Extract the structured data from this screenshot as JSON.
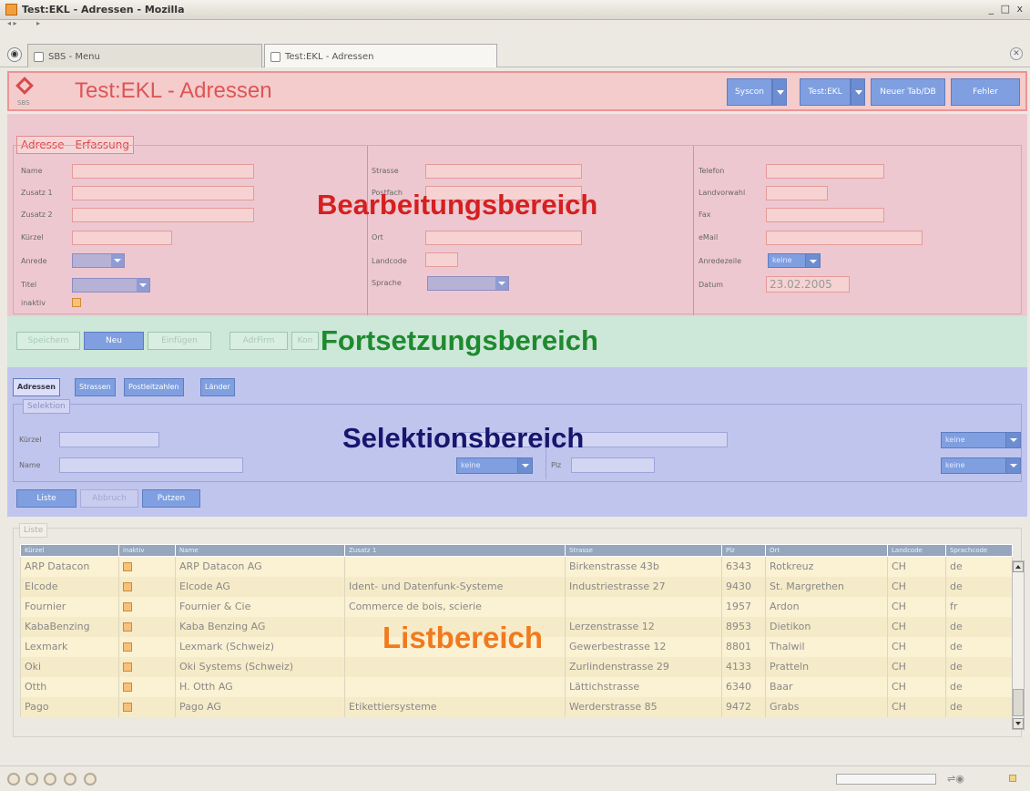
{
  "window": {
    "title": "Test:EKL - Adressen - Mozilla",
    "controls": "_ □ x"
  },
  "browser_tabs": [
    {
      "label": "SBS - Menu"
    },
    {
      "label": "Test:EKL - Adressen"
    }
  ],
  "header": {
    "logo_text": "SBS",
    "title": "Test:EKL - Adressen",
    "buttons": {
      "syscon": "Syscon",
      "testekl": "Test:EKL",
      "neuer_tab": "Neuer Tab/DB",
      "fehler": "Fehler"
    }
  },
  "edit": {
    "section_title": "Adresse - Erfassung",
    "watermark": "Bearbeitungsbereich",
    "labels": {
      "name": "Name",
      "zusatz1": "Zusatz 1",
      "zusatz2": "Zusatz 2",
      "kuerzel": "Kürzel",
      "anrede": "Anrede",
      "titel": "Titel",
      "inaktiv": "inaktiv",
      "strasse": "Strasse",
      "postfach": "Postfach",
      "ort": "Ort",
      "landcode": "Landcode",
      "sprache": "Sprache",
      "telefon": "Telefon",
      "landvorwahl": "Landvorwahl",
      "fax": "Fax",
      "email": "eMail",
      "anredezeile": "Anredezeile",
      "datum": "Datum"
    },
    "anredezeile_value": "keine",
    "datum_value": "23.02.2005"
  },
  "continuation": {
    "watermark": "Fortsetzungsbereich",
    "buttons": {
      "speichern": "Speichern",
      "neu": "Neu",
      "einfuegen": "Einfügen",
      "adrfirm": "AdrFirm",
      "kon": "Kon"
    }
  },
  "selection": {
    "tabs": [
      "Adressen",
      "Strassen",
      "Postleitzahlen",
      "Länder"
    ],
    "section_title": "Selektion",
    "watermark": "Selektionsbereich",
    "labels": {
      "kuerzel": "Kürzel",
      "name": "Name",
      "plz": "Plz"
    },
    "select_values": [
      "keine",
      "keine",
      "keine"
    ],
    "buttons": {
      "liste": "Liste",
      "abbruch": "Abbruch",
      "putzen": "Putzen"
    }
  },
  "list": {
    "section_title": "Liste",
    "watermark": "Listbereich",
    "columns": [
      "Kürzel",
      "inaktiv",
      "Name",
      "Zusatz 1",
      "Strasse",
      "Plz",
      "Ort",
      "Landcode",
      "Sprachcode"
    ],
    "rows": [
      [
        "ARP Datacon",
        "",
        "ARP Datacon AG",
        "",
        "Birkenstrasse 43b",
        "6343",
        "Rotkreuz",
        "CH",
        "de"
      ],
      [
        "Elcode",
        "",
        "Elcode AG",
        "Ident- und Datenfunk-Systeme",
        "Industriestrasse 27",
        "9430",
        "St. Margrethen",
        "CH",
        "de"
      ],
      [
        "Fournier",
        "",
        "Fournier & Cie",
        "Commerce de bois, scierie",
        "",
        "1957",
        "Ardon",
        "CH",
        "fr"
      ],
      [
        "KabaBenzing",
        "",
        "Kaba Benzing AG",
        "",
        "Lerzenstrasse 12",
        "8953",
        "Dietikon",
        "CH",
        "de"
      ],
      [
        "Lexmark",
        "",
        "Lexmark (Schweiz)",
        "",
        "Gewerbestrasse 12",
        "8801",
        "Thalwil",
        "CH",
        "de"
      ],
      [
        "Oki",
        "",
        "Oki Systems (Schweiz)",
        "",
        "Zurlindenstrasse 29",
        "4133",
        "Pratteln",
        "CH",
        "de"
      ],
      [
        "Otth",
        "",
        "H. Otth AG",
        "",
        "Lättichstrasse",
        "6340",
        "Baar",
        "CH",
        "de"
      ],
      [
        "Pago",
        "",
        "Pago AG",
        "Etikettiersysteme",
        "Werderstrasse 85",
        "9472",
        "Grabs",
        "CH",
        "de"
      ]
    ]
  },
  "colors": {
    "edit_bg": "#eec8d0",
    "edit_watermark": "#d42020",
    "continuation_bg": "#cde7d8",
    "continuation_watermark": "#1e8a2e",
    "selection_bg": "#c0c5ee",
    "selection_watermark": "#16166e",
    "list_watermark": "#f07a1e",
    "button_blue": "#7f9fe0"
  }
}
